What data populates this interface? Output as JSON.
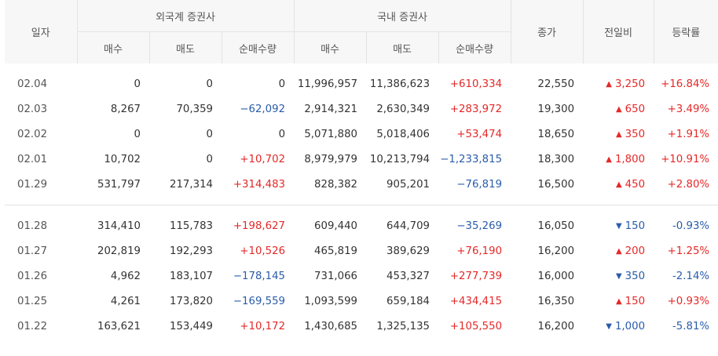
{
  "headers": {
    "date": "일자",
    "foreign_group": "외국계 증권사",
    "domestic_group": "국내 증권사",
    "close": "종가",
    "change": "전일비",
    "rate": "등락률",
    "buy": "매수",
    "sell": "매도",
    "net": "순매수량"
  },
  "group1": [
    {
      "date": "02.04",
      "f_buy": "0",
      "f_sell": "0",
      "f_net": "0",
      "f_net_sign": "zero",
      "d_buy": "11,996,957",
      "d_sell": "11,386,623",
      "d_net": "+610,334",
      "d_net_sign": "pos",
      "close": "22,550",
      "change": "3,250",
      "change_dir": "up",
      "rate": "+16.84%",
      "rate_sign": "pos"
    },
    {
      "date": "02.03",
      "f_buy": "8,267",
      "f_sell": "70,359",
      "f_net": "−62,092",
      "f_net_sign": "neg",
      "d_buy": "2,914,321",
      "d_sell": "2,630,349",
      "d_net": "+283,972",
      "d_net_sign": "pos",
      "close": "19,300",
      "change": "650",
      "change_dir": "up",
      "rate": "+3.49%",
      "rate_sign": "pos"
    },
    {
      "date": "02.02",
      "f_buy": "0",
      "f_sell": "0",
      "f_net": "0",
      "f_net_sign": "zero",
      "d_buy": "5,071,880",
      "d_sell": "5,018,406",
      "d_net": "+53,474",
      "d_net_sign": "pos",
      "close": "18,650",
      "change": "350",
      "change_dir": "up",
      "rate": "+1.91%",
      "rate_sign": "pos"
    },
    {
      "date": "02.01",
      "f_buy": "10,702",
      "f_sell": "0",
      "f_net": "+10,702",
      "f_net_sign": "pos",
      "d_buy": "8,979,979",
      "d_sell": "10,213,794",
      "d_net": "−1,233,815",
      "d_net_sign": "neg",
      "close": "18,300",
      "change": "1,800",
      "change_dir": "up",
      "rate": "+10.91%",
      "rate_sign": "pos"
    },
    {
      "date": "01.29",
      "f_buy": "531,797",
      "f_sell": "217,314",
      "f_net": "+314,483",
      "f_net_sign": "pos",
      "d_buy": "828,382",
      "d_sell": "905,201",
      "d_net": "−76,819",
      "d_net_sign": "neg",
      "close": "16,500",
      "change": "450",
      "change_dir": "up",
      "rate": "+2.80%",
      "rate_sign": "pos"
    }
  ],
  "group2": [
    {
      "date": "01.28",
      "f_buy": "314,410",
      "f_sell": "115,783",
      "f_net": "+198,627",
      "f_net_sign": "pos",
      "d_buy": "609,440",
      "d_sell": "644,709",
      "d_net": "−35,269",
      "d_net_sign": "neg",
      "close": "16,050",
      "change": "150",
      "change_dir": "down",
      "rate": "-0.93%",
      "rate_sign": "neg"
    },
    {
      "date": "01.27",
      "f_buy": "202,819",
      "f_sell": "192,293",
      "f_net": "+10,526",
      "f_net_sign": "pos",
      "d_buy": "465,819",
      "d_sell": "389,629",
      "d_net": "+76,190",
      "d_net_sign": "pos",
      "close": "16,200",
      "change": "200",
      "change_dir": "up",
      "rate": "+1.25%",
      "rate_sign": "pos"
    },
    {
      "date": "01.26",
      "f_buy": "4,962",
      "f_sell": "183,107",
      "f_net": "−178,145",
      "f_net_sign": "neg",
      "d_buy": "731,066",
      "d_sell": "453,327",
      "d_net": "+277,739",
      "d_net_sign": "pos",
      "close": "16,000",
      "change": "350",
      "change_dir": "down",
      "rate": "-2.14%",
      "rate_sign": "neg"
    },
    {
      "date": "01.25",
      "f_buy": "4,261",
      "f_sell": "173,820",
      "f_net": "−169,559",
      "f_net_sign": "neg",
      "d_buy": "1,093,599",
      "d_sell": "659,184",
      "d_net": "+434,415",
      "d_net_sign": "pos",
      "close": "16,350",
      "change": "150",
      "change_dir": "up",
      "rate": "+0.93%",
      "rate_sign": "pos"
    },
    {
      "date": "01.22",
      "f_buy": "163,621",
      "f_sell": "153,449",
      "f_net": "+10,172",
      "f_net_sign": "pos",
      "d_buy": "1,430,685",
      "d_sell": "1,325,135",
      "d_net": "+105,550",
      "d_net_sign": "pos",
      "close": "16,200",
      "change": "1,000",
      "change_dir": "down",
      "rate": "-5.81%",
      "rate_sign": "neg"
    }
  ],
  "colors": {
    "up": "#e52828",
    "down": "#2a5caa",
    "header_bg": "#f7f7f7",
    "border": "#e3e3e3"
  },
  "icons": {
    "up": "triangle-up-icon",
    "down": "triangle-down-icon"
  }
}
